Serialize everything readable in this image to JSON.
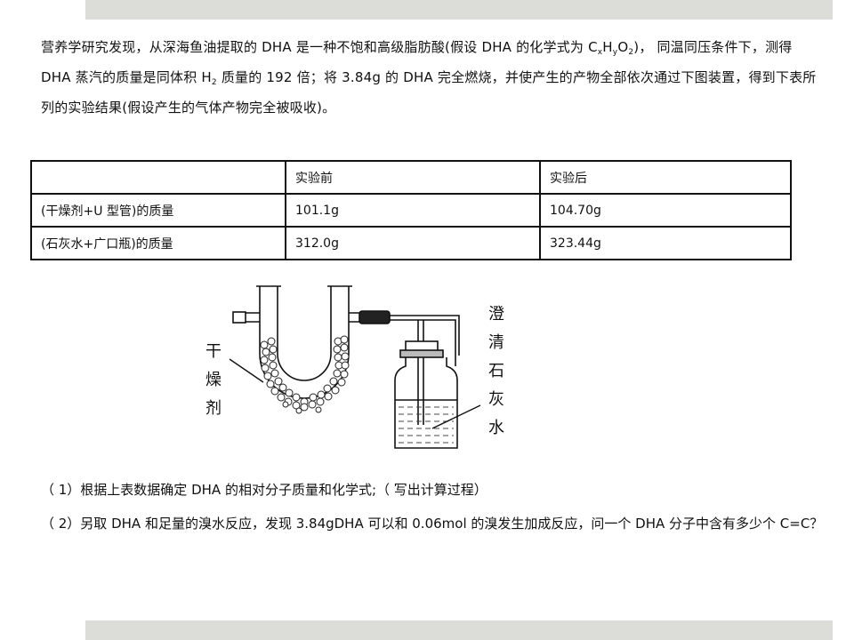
{
  "intro": {
    "p1": "营养学研究发现，从深海鱼油提取的 DHA 是一种不饱和高级脂肪酸(假设 DHA 的化学式为 C",
    "sub_x": "x",
    "mid_h": "H",
    "sub_y": "y",
    "mid_o": "O",
    "sub_2": "2",
    "p2": ")， 同温同压条件下，测得 DHA 蒸汽的质量是同体积 H",
    "sub_h2": "2",
    "p3": " 质量的 192 倍；将 3.84g 的 DHA 完全燃烧，并使产生的产物全部依次通过下图装置，得到下表所列的实验结果(假设产生的气体产物完全被吸收)。"
  },
  "table": {
    "headers": [
      "",
      "实验前",
      "实验后"
    ],
    "rows": [
      [
        "(干燥剂+U 型管)的质量",
        "101.1g",
        "104.70g"
      ],
      [
        "(石灰水+广口瓶)的质量",
        "312.0g",
        "323.44g"
      ]
    ]
  },
  "diagram": {
    "left_label": [
      "干",
      "燥",
      "剂"
    ],
    "right_label": [
      "澄",
      "清",
      "石",
      "灰",
      "水"
    ]
  },
  "questions": {
    "q1": "（ 1）根据上表数据确定 DHA 的相对分子质量和化学式;（ 写出计算过程）",
    "q2": "（ 2）另取 DHA 和足量的溴水反应，发现 3.84gDHA 可以和 0.06mol 的溴发生加成反应，问一个 DHA 分子中含有多少个 C=C？"
  }
}
